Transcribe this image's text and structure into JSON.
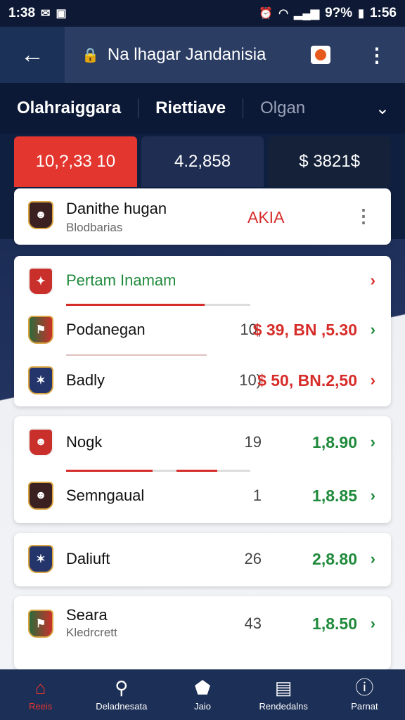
{
  "status_bar": {
    "time_left": "1:38",
    "battery": "9?%",
    "time_right": "1:56"
  },
  "app_bar": {
    "title": "Na lhagar Jandanisia"
  },
  "tabs": [
    {
      "label": "Olahraiggara"
    },
    {
      "label": "Riettiave"
    },
    {
      "label": "Olgan"
    }
  ],
  "summary": [
    {
      "value": "10,?,33 10"
    },
    {
      "value": "4.2,858"
    },
    {
      "value": "$ 3821$"
    }
  ],
  "header_card": {
    "name": "Danithe hugan",
    "sub": "Blodbarias",
    "badge": "AKIA"
  },
  "groups": [
    {
      "title": "Pertam Inamam",
      "title_progress": 0.75,
      "rows": [
        {
          "name": "Podanegan",
          "count": "10,",
          "odds": "$ 39, BN ,5.30",
          "odds_color": "#d62d2a",
          "chev_color": "#1f8a3b",
          "crest": "flag-crest-icon"
        },
        {
          "name": "Badly",
          "count": "10)",
          "odds": "$ 50, BN.2,50",
          "odds_color": "#d62d2a",
          "chev_color": "#d62d2a",
          "crest": "shield-crest-icon"
        }
      ]
    },
    {
      "rows": [
        {
          "name": "Nogk",
          "count": "19",
          "odds": "1,8.90",
          "crest": "player-crest-icon"
        },
        {
          "name": "Semngaual",
          "count": "1",
          "odds": "1,8.85",
          "crest": "player-crest-icon"
        }
      ]
    },
    {
      "rows": [
        {
          "name": "Daliuft",
          "count": "26",
          "odds": "2,8.80",
          "crest": "shield-crest-icon"
        }
      ]
    },
    {
      "rows": [
        {
          "name": "Seara",
          "sub": "Kledrcrett",
          "count": "43",
          "odds": "1,8.50",
          "crest": "flag-crest-icon"
        }
      ]
    }
  ],
  "bottom_nav": [
    {
      "label": "Reeis",
      "icon": "home-icon",
      "active": true
    },
    {
      "label": "Deladnesata",
      "icon": "search-icon"
    },
    {
      "label": "Jaio",
      "icon": "shield-icon"
    },
    {
      "label": "Rendedalns",
      "icon": "ticket-icon"
    },
    {
      "label": "Parnat",
      "icon": "info-icon"
    }
  ],
  "colors": {
    "accent_red": "#e3362f",
    "green": "#1f8a3b",
    "navy": "#1c3158"
  }
}
